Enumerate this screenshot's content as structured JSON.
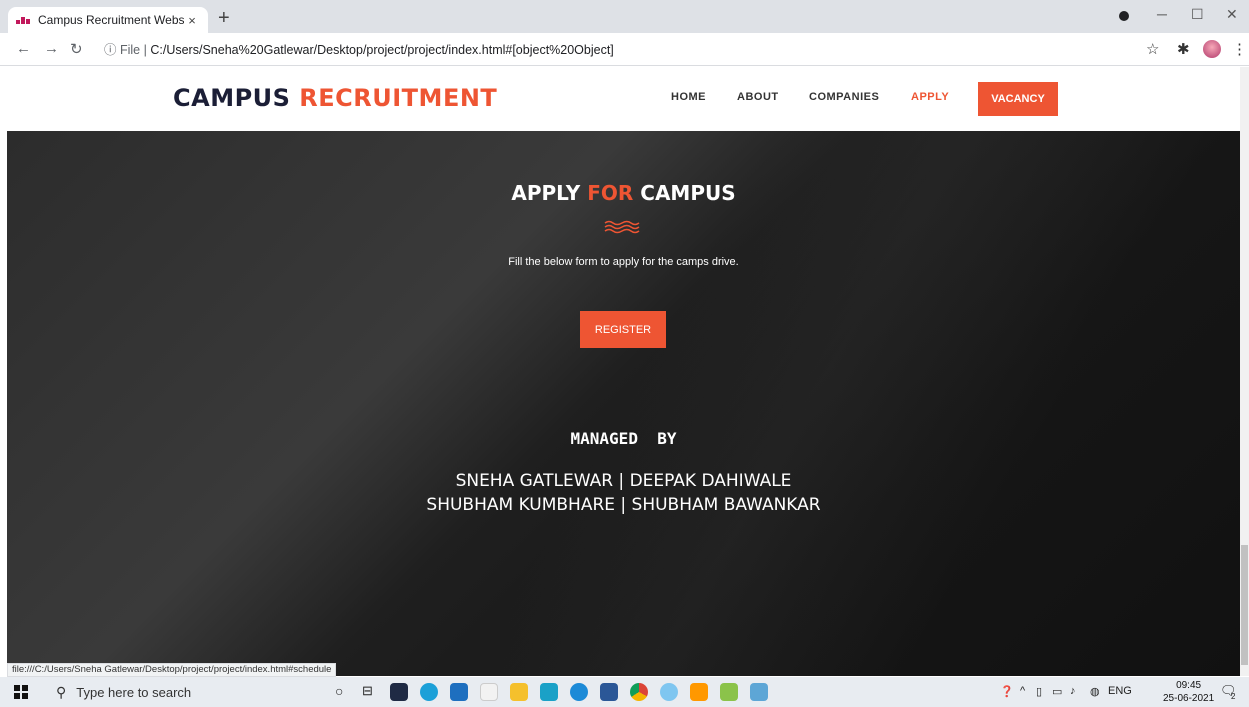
{
  "browser": {
    "tab_title": "Campus Recruitment Website",
    "tab_close": "×",
    "new_tab": "+",
    "url_prefix": "File",
    "url": "C:/Users/Sneha%20Gatlewar/Desktop/project/project/index.html#[object%20Object]",
    "status_url": "file:///C:/Users/Sneha Gatlewar/Desktop/project/project/index.html#schedule"
  },
  "site": {
    "logo_part1": "CAMPUS",
    "logo_part2": "RECRUITMENT",
    "nav": {
      "home": "HOME",
      "about": "ABOUT",
      "companies": "COMPANIES",
      "apply": "APPLY",
      "vacancy": "VACANCY"
    },
    "accent_color": "#ee5533"
  },
  "hero": {
    "title_part1": "APPLY",
    "title_part2": "FOR",
    "title_part3": "CAMPUS",
    "subtitle": "Fill the below form to apply for the camps drive.",
    "register_label": "REGISTER",
    "managed_by": "MANAGED  BY",
    "names_line1": "SNEHA GATLEWAR | DEEPAK DAHIWALE",
    "names_line2": "SHUBHAM KUMBHARE | SHUBHAM BAWANKAR"
  },
  "taskbar": {
    "search_placeholder": "Type here to search",
    "language": "ENG",
    "time": "09:45",
    "date": "25-06-2021",
    "notification_count": "2"
  }
}
